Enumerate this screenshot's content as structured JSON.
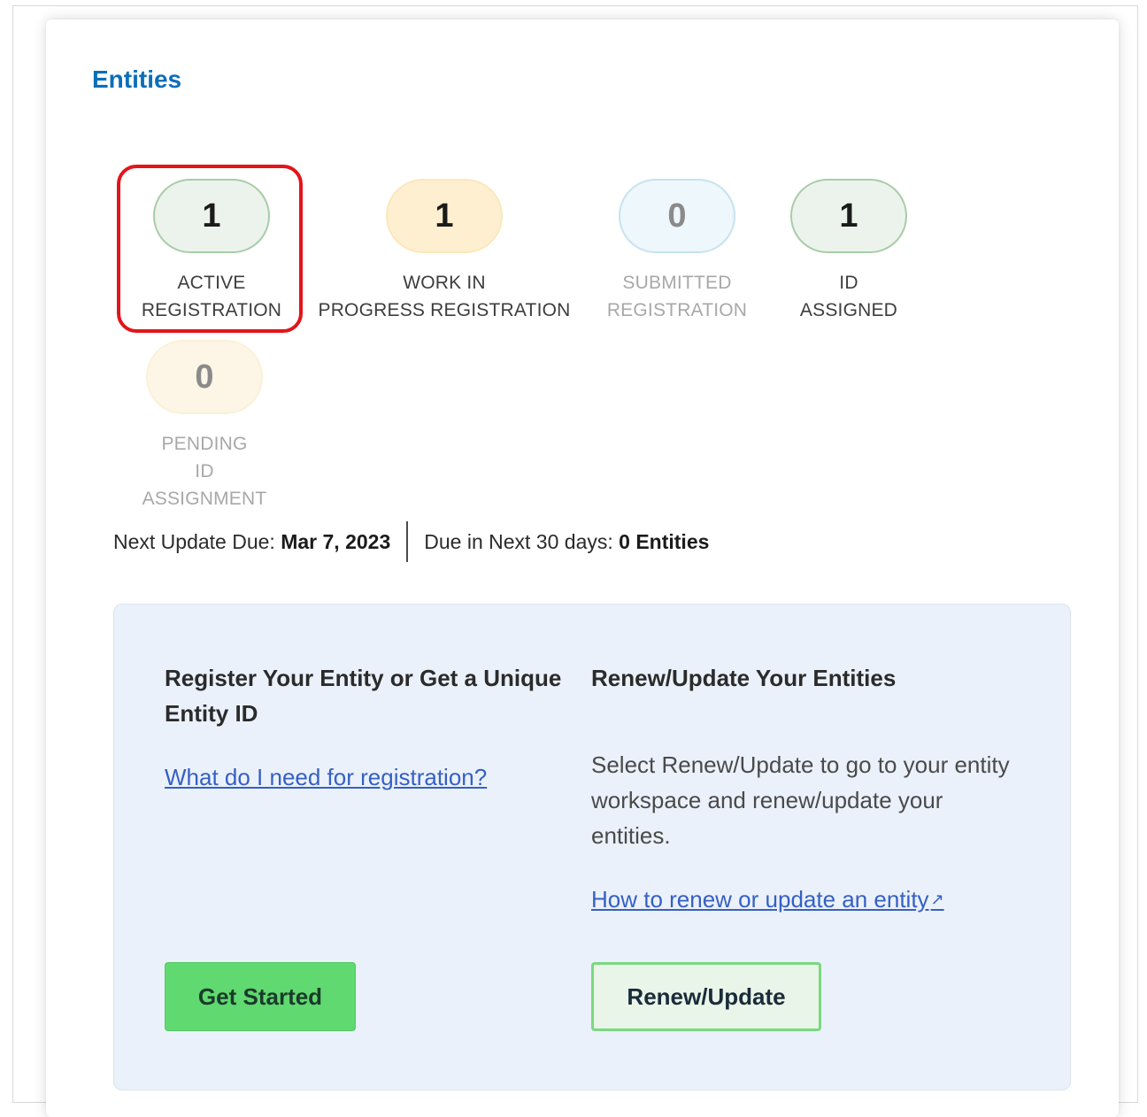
{
  "page": {
    "title": "Entities",
    "accent_color": "#0a6fb8",
    "highlight_color": "#e4141b"
  },
  "counters": [
    {
      "count": "1",
      "label": "ACTIVE\nREGISTRATION"
    },
    {
      "count": "1",
      "label": "WORK IN\nPROGRESS REGISTRATION"
    },
    {
      "count": "0",
      "label": "SUBMITTED\nREGISTRATION"
    },
    {
      "count": "1",
      "label": "ID\nASSIGNED"
    },
    {
      "count": "0",
      "label": "PENDING\nID\nASSIGNMENT"
    }
  ],
  "summary": {
    "next_update_label": "Next Update Due:",
    "next_update_value": "Mar 7, 2023",
    "due_label": "Due in Next 30 days:",
    "due_value": "0 Entities"
  },
  "register": {
    "heading": "Register Your Entity or Get a Unique Entity ID",
    "link": "What do I need for registration?",
    "button": "Get Started"
  },
  "renew": {
    "heading": "Renew/Update Your Entities",
    "description": "Select Renew/Update to go to your entity workspace and renew/update your entities.",
    "link": "How to renew or update an entity",
    "link_icon": "external-link-icon",
    "button": "Renew/Update"
  }
}
